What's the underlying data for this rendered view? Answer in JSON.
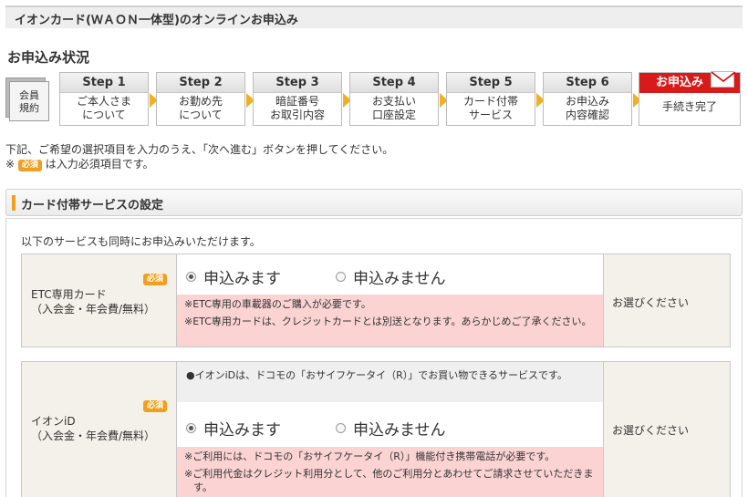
{
  "header": {
    "title": "イオンカード(ＷＡＯＮ一体型)のオンラインお申込み"
  },
  "status_title": "お申込み状況",
  "member_badge": {
    "line1": "会員",
    "line2": "規約"
  },
  "steps": [
    {
      "label": "Step 1",
      "line1": "ご本人さま",
      "line2": "について"
    },
    {
      "label": "Step 2",
      "line1": "お勤め先",
      "line2": "について"
    },
    {
      "label": "Step 3",
      "line1": "暗証番号",
      "line2": "お取引内容"
    },
    {
      "label": "Step 4",
      "line1": "お支払い",
      "line2": "口座設定"
    },
    {
      "label": "Step 5",
      "line1": "カード付帯",
      "line2": "サービス"
    },
    {
      "label": "Step 6",
      "line1": "お申込み",
      "line2": "内容確認"
    }
  ],
  "final_step": {
    "label": "お申込み",
    "text": "手続き完了"
  },
  "instructions": {
    "line1": "下記、ご希望の選択項目を入力のうえ、「次へ進む」ボタンを押してください。",
    "prefix": "※",
    "badge": "必須",
    "line2_suffix": "は入力必須項目です。"
  },
  "section": {
    "title": "カード付帯サービスの設定"
  },
  "intro": "以下のサービスも同時にお申込みいただけます。",
  "services": [
    {
      "name_line1": "ETC専用カード",
      "name_line2": "（入会金・年会費/無料）",
      "badge": "必須",
      "option_yes": "申込みます",
      "option_no": "申込みません",
      "selected": "yes",
      "notices": [
        "※ETC専用の車載器のご購入が必要です。",
        "※ETC専用カードは、クレジットカードとは別送となります。あらかじめご了承ください。"
      ],
      "status": "お選びください"
    },
    {
      "name_line1": "イオンiD",
      "name_line2": "（入会金・年会費/無料）",
      "badge": "必須",
      "info": "●イオンiDは、ドコモの「おサイフケータイ（R）」でお買い物できるサービスです。",
      "option_yes": "申込みます",
      "option_no": "申込みません",
      "selected": "yes",
      "notices": [
        "※ご利用には、ドコモの「おサイフケータイ（R）」機能付き携帯電話が必要です。",
        "※ご利用代金はクレジット利用分として、他のご利用分とあわせてご請求させていただきます。"
      ],
      "status": "お選びください"
    }
  ],
  "colors": {
    "accent": "#f0a020",
    "final_red": "#d91a1a",
    "notice_bg": "#fbd3d3"
  }
}
